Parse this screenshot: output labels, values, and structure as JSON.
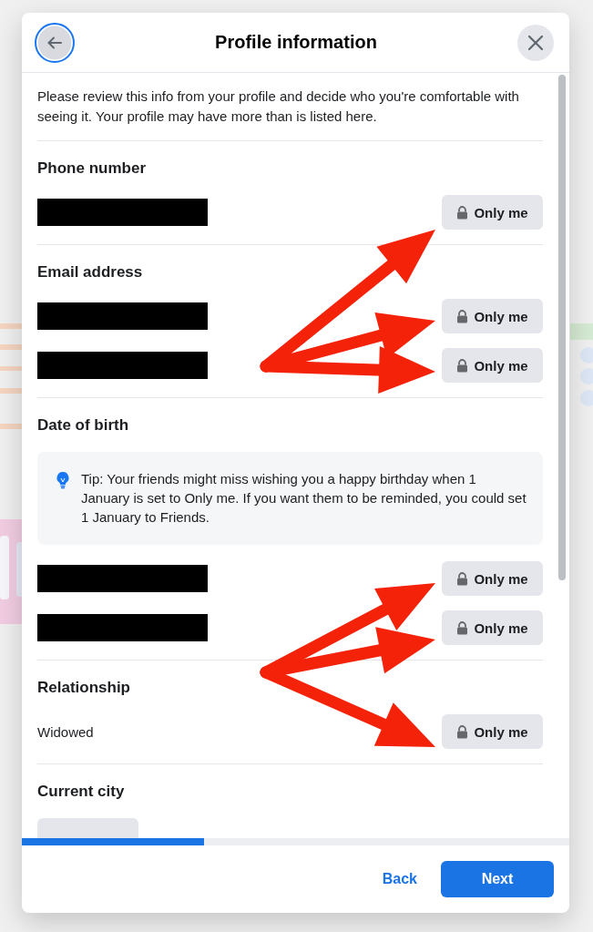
{
  "dialog": {
    "title": "Profile information",
    "intro": "Please review this info from your profile and decide who you're comfortable with seeing it. Your profile may have more than is listed here.",
    "sections": [
      {
        "title": "Phone number",
        "rows": [
          {
            "kind": "redacted",
            "audience": "Only me"
          }
        ]
      },
      {
        "title": "Email address",
        "rows": [
          {
            "kind": "redacted",
            "audience": "Only me"
          },
          {
            "kind": "redacted",
            "audience": "Only me"
          }
        ]
      },
      {
        "title": "Date of birth",
        "tip": "Tip: Your friends might miss wishing you a happy birthday when 1 January is set to Only me. If you want them to be reminded, you could set 1 January to Friends.",
        "rows": [
          {
            "kind": "redacted",
            "audience": "Only me"
          },
          {
            "kind": "redacted",
            "audience": "Only me"
          }
        ]
      },
      {
        "title": "Relationship",
        "rows": [
          {
            "kind": "text",
            "value": "Widowed",
            "audience": "Only me"
          }
        ]
      },
      {
        "title": "Current city",
        "rows": [
          {
            "kind": "clipped"
          }
        ]
      }
    ],
    "progress": {
      "level": 0.333
    },
    "buttons": [
      {
        "label": "Back",
        "kind": "link"
      },
      {
        "label": "Next",
        "kind": "primary"
      }
    ]
  }
}
